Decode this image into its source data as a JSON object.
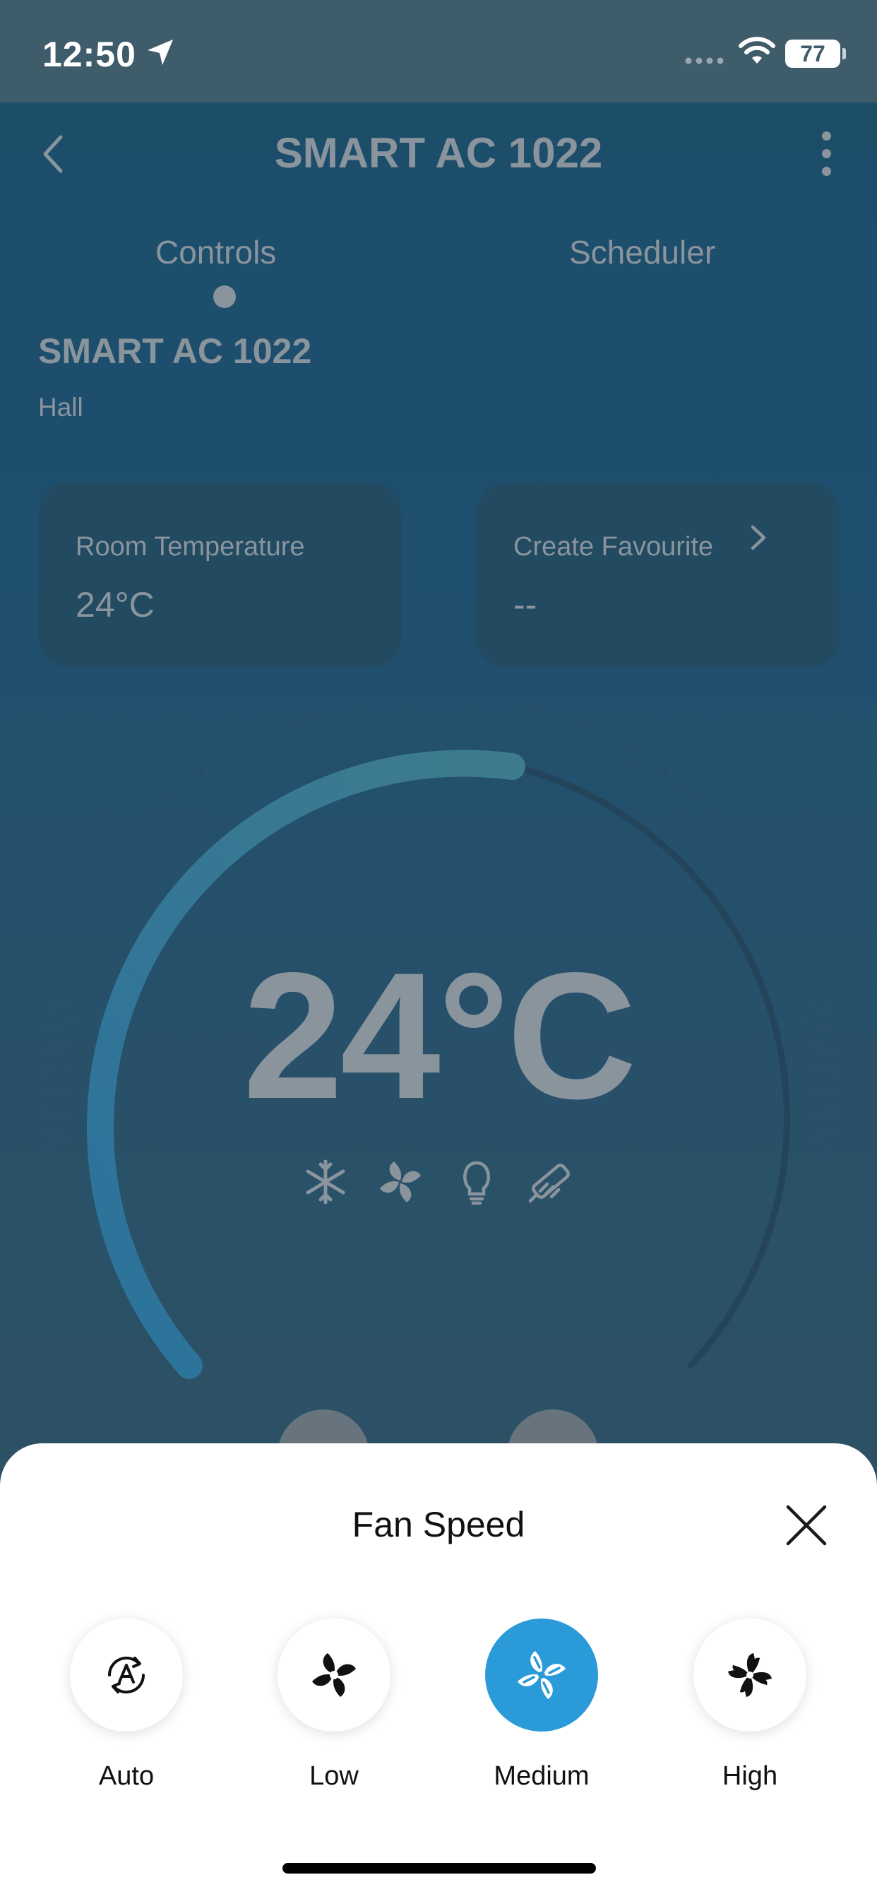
{
  "status_bar": {
    "time": "12:50",
    "battery": "77"
  },
  "header": {
    "title": "SMART AC 1022"
  },
  "tabs": [
    {
      "label": "Controls",
      "active": true
    },
    {
      "label": "Scheduler",
      "active": false
    }
  ],
  "device": {
    "name": "SMART AC 1022",
    "room": "Hall"
  },
  "cards": {
    "room_temperature": {
      "label": "Room Temperature",
      "value": "24°C"
    },
    "favourite": {
      "label": "Create Favourite",
      "value": "--"
    }
  },
  "dial": {
    "set_temperature": "24°C",
    "arc_fill_fraction": 0.46
  },
  "mode_icons": [
    "snowflake-icon",
    "fan-icon",
    "bulb-icon",
    "swing-icon"
  ],
  "fan_speed_sheet": {
    "title": "Fan Speed",
    "options": [
      {
        "label": "Auto",
        "icon": "fan-auto-icon",
        "selected": false
      },
      {
        "label": "Low",
        "icon": "fan-low-icon",
        "selected": false
      },
      {
        "label": "Medium",
        "icon": "fan-medium-icon",
        "selected": true
      },
      {
        "label": "High",
        "icon": "fan-high-icon",
        "selected": false
      }
    ]
  },
  "colors": {
    "accent": "#2b9ad8",
    "sheet_bg": "#ffffff",
    "screen_bg": "#1e5070"
  }
}
